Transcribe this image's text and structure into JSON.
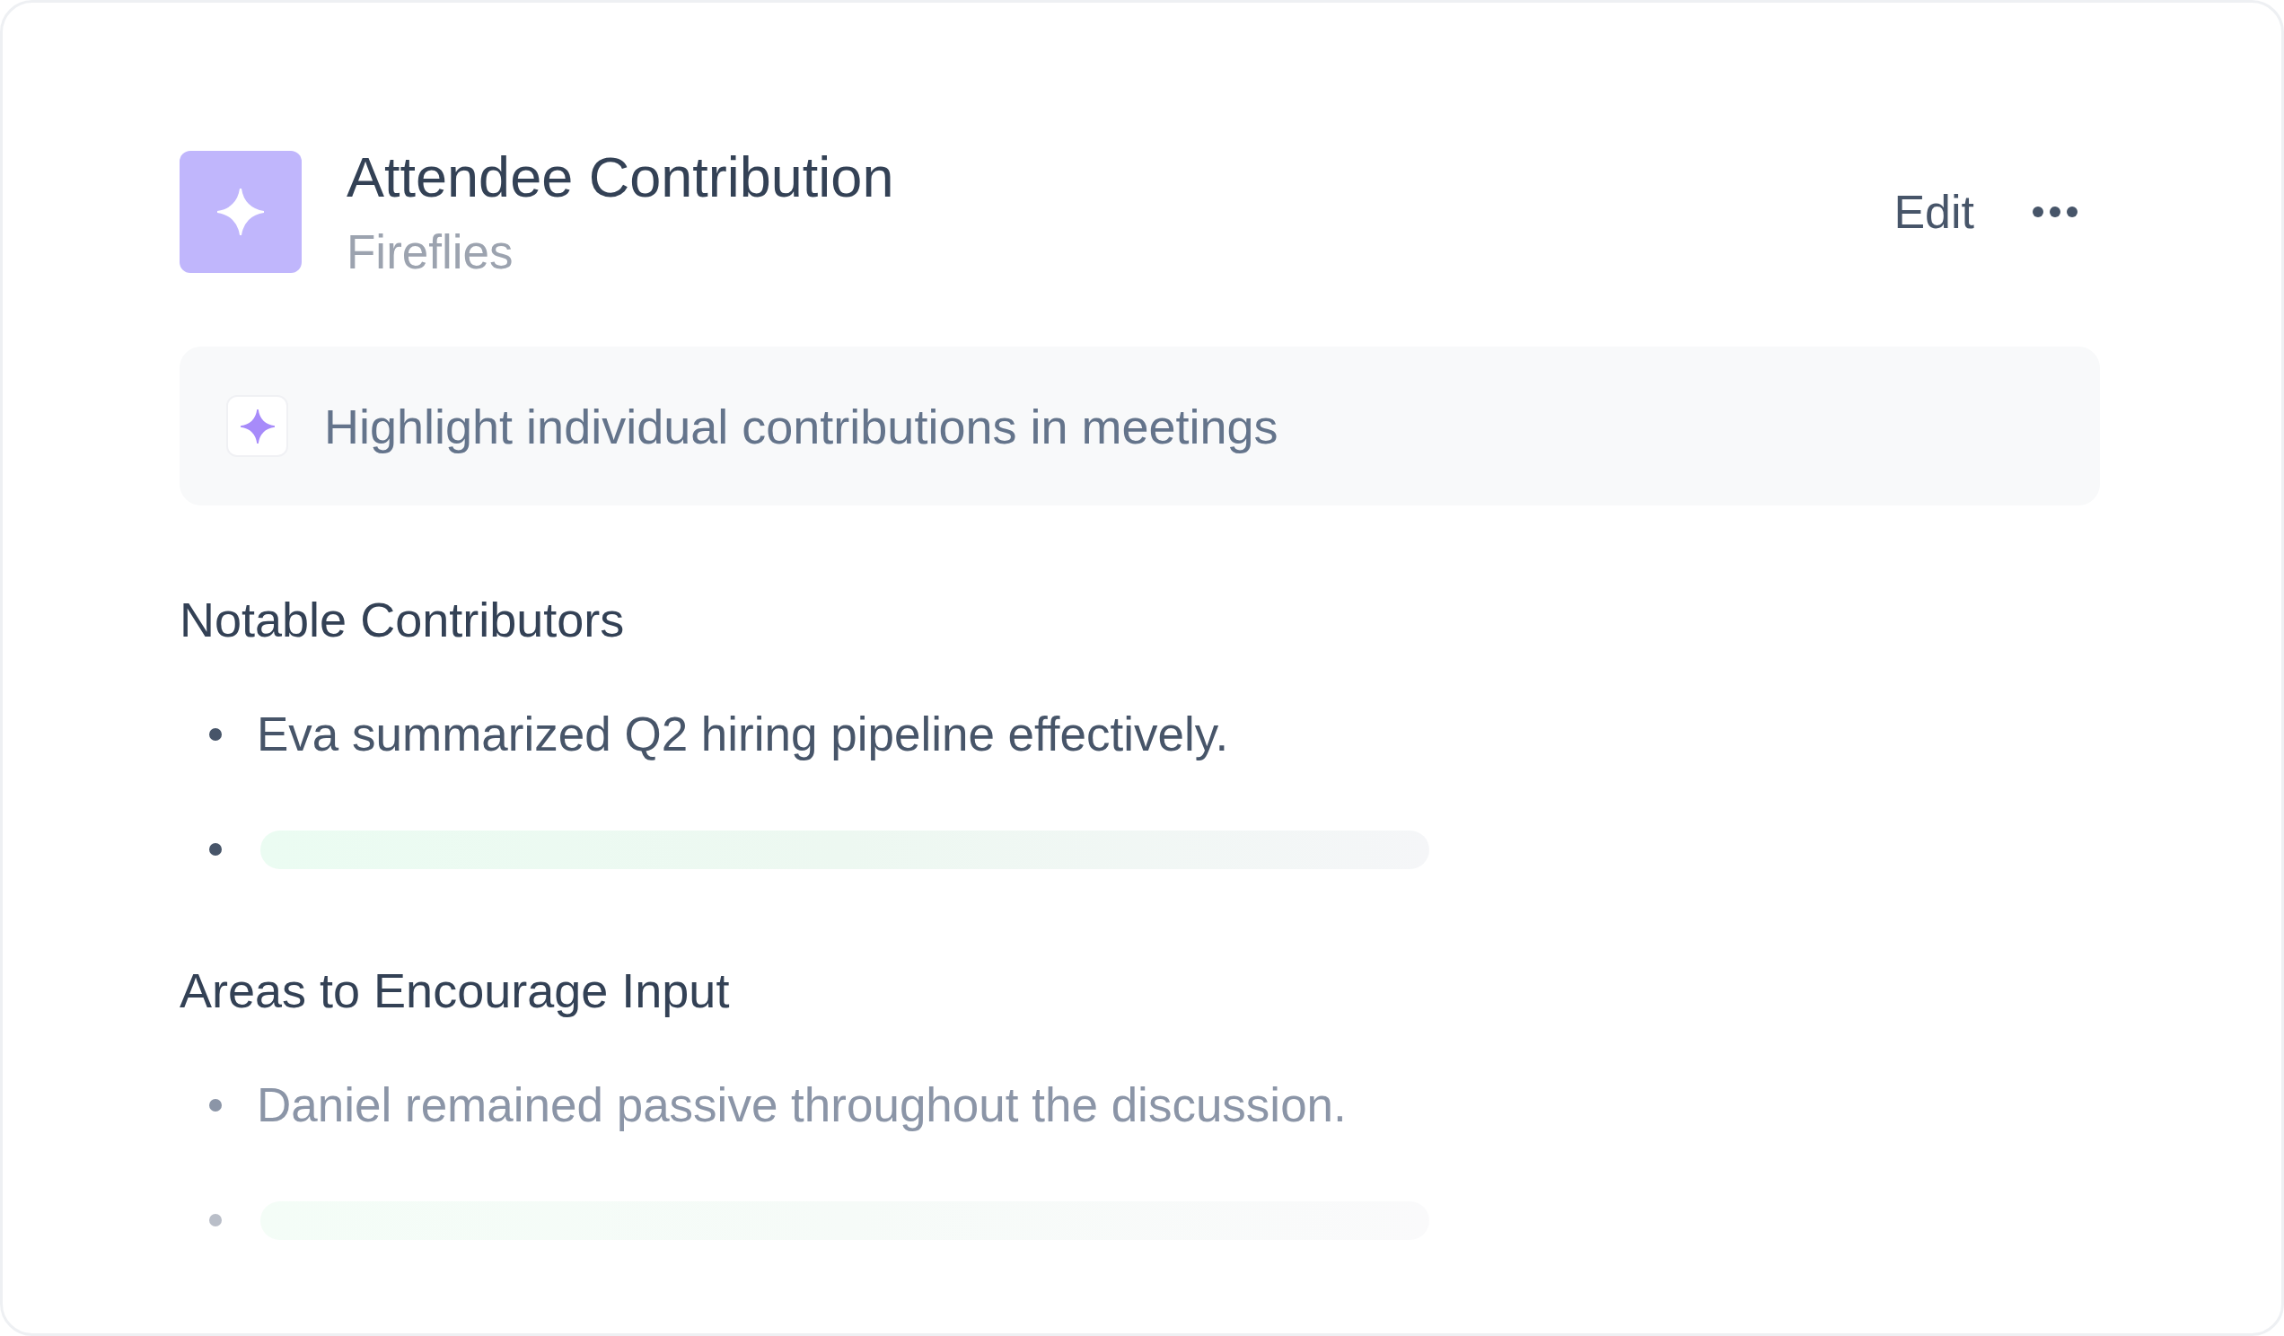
{
  "header": {
    "title": "Attendee Contribution",
    "subtitle": "Fireflies",
    "edit_label": "Edit"
  },
  "prompt": {
    "text": "Highlight individual contributions in meetings"
  },
  "sections": [
    {
      "heading": "Notable Contributors",
      "items": [
        {
          "kind": "text",
          "text": "Eva summarized Q2 hiring pipeline effectively.",
          "dimmed": false
        },
        {
          "kind": "skeleton",
          "dimmed": false
        }
      ]
    },
    {
      "heading": "Areas to Encourage Input",
      "items": [
        {
          "kind": "text",
          "text": "Daniel remained passive throughout the discussion.",
          "dimmed": true
        },
        {
          "kind": "skeleton",
          "dimmed": true
        }
      ]
    }
  ]
}
